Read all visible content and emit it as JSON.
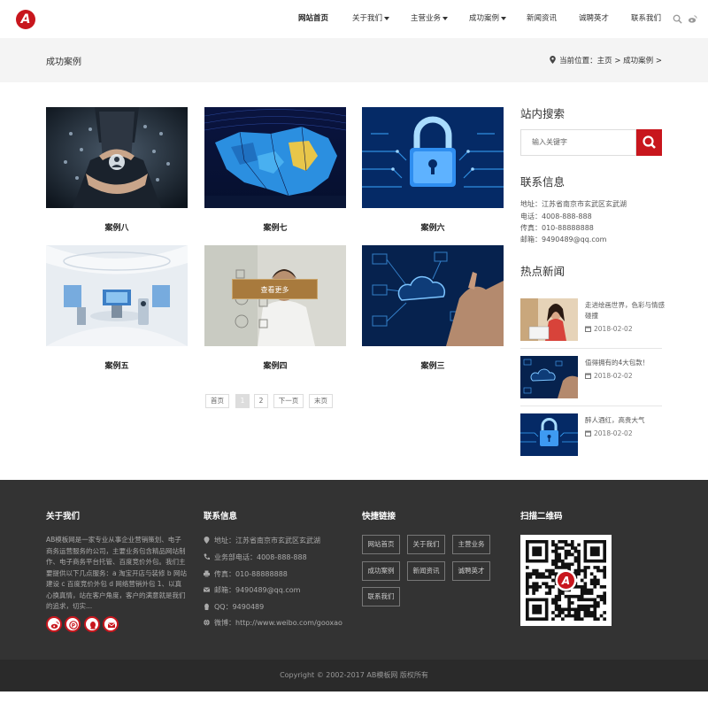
{
  "header": {
    "logo_letter": "A",
    "nav": [
      {
        "label": "网站首页",
        "dropdown": false,
        "active": true
      },
      {
        "label": "关于我们",
        "dropdown": true
      },
      {
        "label": "主营业务",
        "dropdown": true
      },
      {
        "label": "成功案例",
        "dropdown": true
      },
      {
        "label": "新闻资讯",
        "dropdown": false
      },
      {
        "label": "诚聘英才",
        "dropdown": false
      },
      {
        "label": "联系我们",
        "dropdown": false
      }
    ],
    "icons": [
      "search-icon",
      "weibo-icon"
    ]
  },
  "banner": {
    "title": "成功案例",
    "location_label": "当前位置：",
    "crumbs": "主页 > 成功案例 >"
  },
  "cases": [
    {
      "title": "案例八",
      "image": "business-hands-icons"
    },
    {
      "title": "案例七",
      "image": "blue-map"
    },
    {
      "title": "案例六",
      "image": "digital-padlock"
    },
    {
      "title": "案例五",
      "image": "white-futuristic-room"
    },
    {
      "title": "案例四",
      "image": "man-with-icons",
      "hover_label": "查看更多"
    },
    {
      "title": "案例三",
      "image": "cloud-network-hand"
    }
  ],
  "pagination": {
    "first": "首页",
    "pages": [
      "1",
      "2"
    ],
    "current": "1",
    "next": "下一页",
    "last": "末页"
  },
  "sidebar": {
    "search_heading": "站内搜索",
    "search_placeholder": "输入关键字",
    "contact_heading": "联系信息",
    "contact_lines": [
      "地址：江苏省南京市玄武区玄武湖",
      "电话：4008-888-888",
      "传真：010-88888888",
      "邮箱：9490489@qq.com"
    ],
    "news_heading": "热点新闻",
    "news": [
      {
        "title": "走进绘画世界，色彩与情感碰撞",
        "date": "2018-02-02"
      },
      {
        "title": "值得拥有的4大包款！",
        "date": "2018-02-02"
      },
      {
        "title": "醉人酒红，高贵大气",
        "date": "2018-02-02"
      }
    ]
  },
  "footer": {
    "about_heading": "关于我们",
    "about_text": "AB模板网是一家专业从事企业营销策划、电子商务运营服务的公司，主要业务包含精品网站制作、电子商务平台托管、百度竞价外包。我们主要提供以下几点服务：a 淘宝开店与装修 b 网站建设 c 百度竞价外包 d 网络营销外包 1、以真心换真情，站在客户角度，客户的满意就是我们的追求，切实...",
    "social_icons": [
      "weibo-icon",
      "alipay-icon",
      "qq-icon",
      "email-icon"
    ],
    "contact_heading": "联系信息",
    "contact_lines": [
      {
        "icon": "location-icon",
        "text": "地址：江苏省南京市玄武区玄武湖"
      },
      {
        "icon": "phone-icon",
        "text": "业务部电话：4008-888-888"
      },
      {
        "icon": "print-icon",
        "text": "传真：010-88888888"
      },
      {
        "icon": "email-icon",
        "text": "邮箱：9490489@qq.com"
      },
      {
        "icon": "qq-icon",
        "text": "QQ：9490489"
      },
      {
        "icon": "globe-icon",
        "text": "微博：http://www.weibo.com/gooxao"
      }
    ],
    "links_heading": "快捷链接",
    "links": [
      "网站首页",
      "关于我们",
      "主营业务",
      "成功案例",
      "新闻资讯",
      "诚聘英才",
      "联系我们"
    ],
    "qr_heading": "扫描二维码",
    "copyright": "Copyright © 2002-2017 AB模板网 版权所有"
  },
  "colors": {
    "accent": "#c8161d",
    "footer_bg": "#333333",
    "copyright_bg": "#2a2a2a",
    "banner_bg": "#f4f4f4",
    "button_gold": "#a87a3d"
  }
}
